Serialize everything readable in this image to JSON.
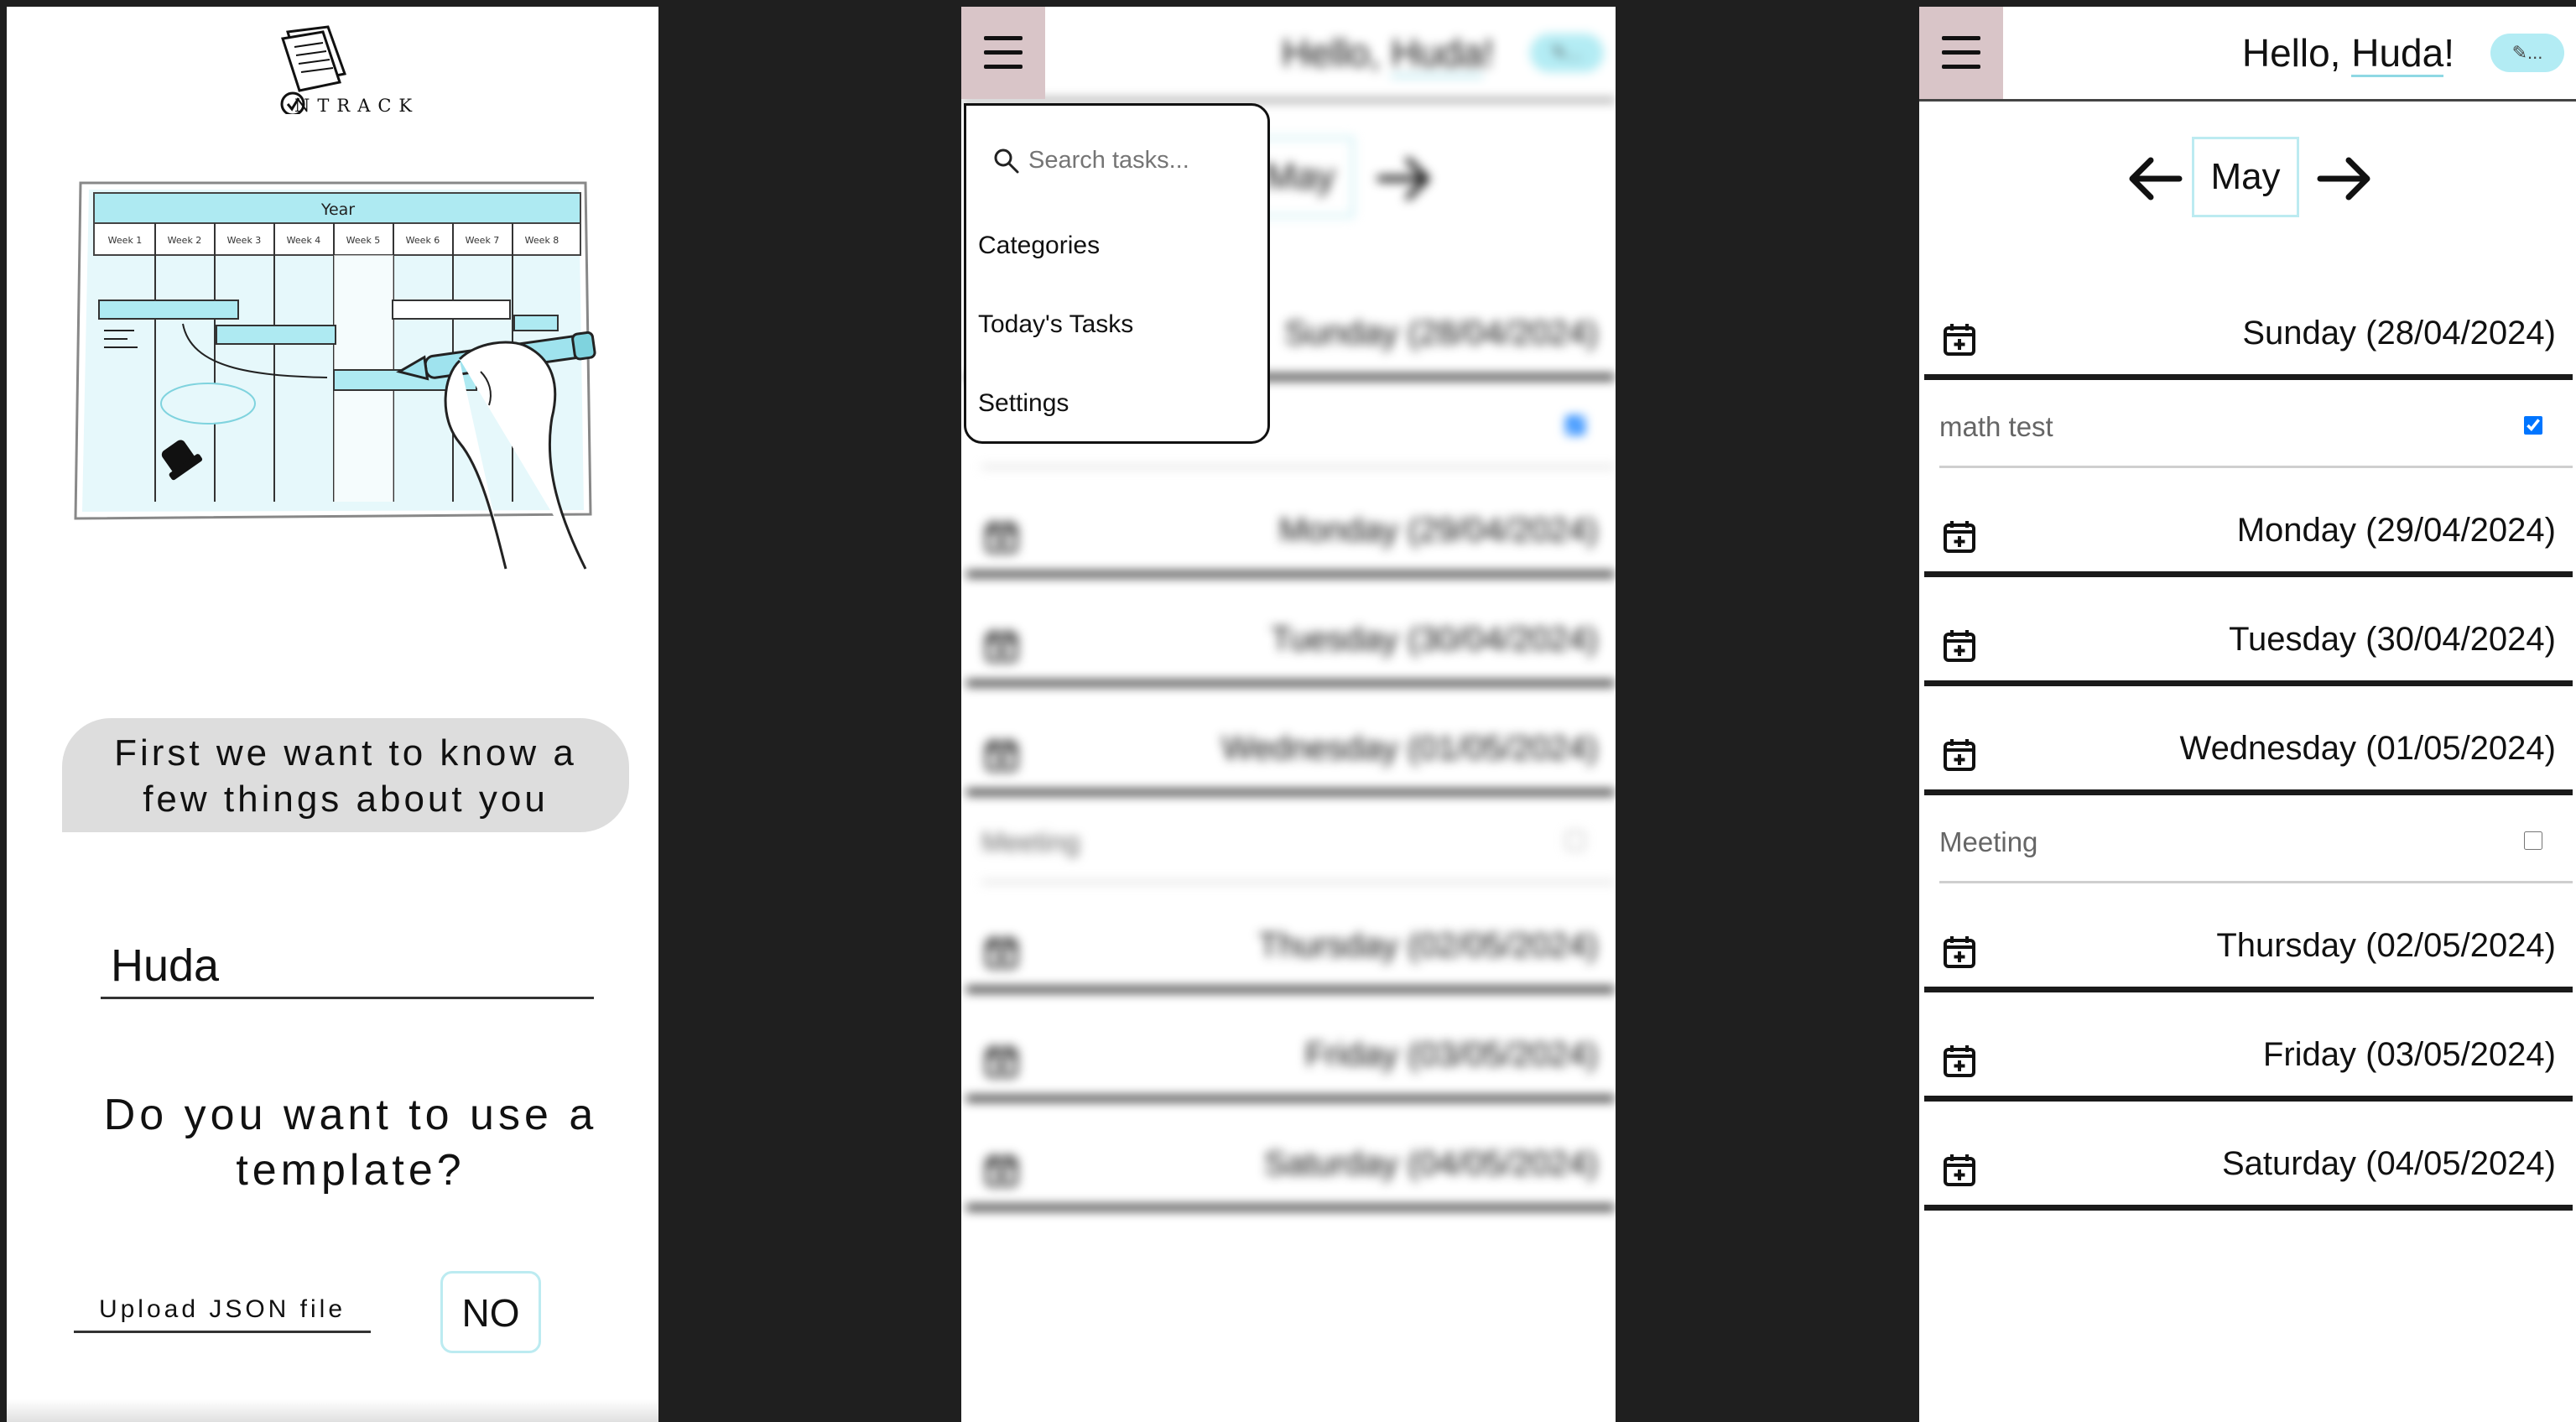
{
  "onboarding": {
    "logo_text": "NTRACK",
    "illustration": {
      "heading": "Year",
      "weeks": [
        "Week 1",
        "Week 2",
        "Week 3",
        "Week 4",
        "Week 5",
        "Week 6",
        "Week 7",
        "Week 8"
      ]
    },
    "prompt_line1": "First we want to know a",
    "prompt_line2": "few things about you",
    "name_value": "Huda",
    "question_line1": "Do you want to use a",
    "question_line2": "template?",
    "upload_label": "Upload JSON file",
    "no_label": "NO"
  },
  "app": {
    "greeting_prefix": "Hello, ",
    "user_name": "Huda",
    "greeting_suffix": "!",
    "avatar_text": "✎...",
    "month": "May",
    "days": [
      {
        "label": "Sunday (28/04/2024)",
        "tasks": [
          {
            "title": "math test",
            "done": true
          }
        ]
      },
      {
        "label": "Monday (29/04/2024)",
        "tasks": []
      },
      {
        "label": "Tuesday (30/04/2024)",
        "tasks": []
      },
      {
        "label": "Wednesday (01/05/2024)",
        "tasks": [
          {
            "title": "Meeting",
            "done": false
          }
        ]
      },
      {
        "label": "Thursday (02/05/2024)",
        "tasks": []
      },
      {
        "label": "Friday (03/05/2024)",
        "tasks": []
      },
      {
        "label": "Saturday (04/05/2024)",
        "tasks": []
      }
    ]
  },
  "menu": {
    "search_placeholder": "Search tasks...",
    "items": [
      "Categories",
      "Today's Tasks",
      "Settings"
    ]
  },
  "colors": {
    "accent": "#b3ecf4",
    "menu_button": "#d9c5c8",
    "checkbox": "#1a73e8",
    "divider": "#1a1a1a"
  }
}
